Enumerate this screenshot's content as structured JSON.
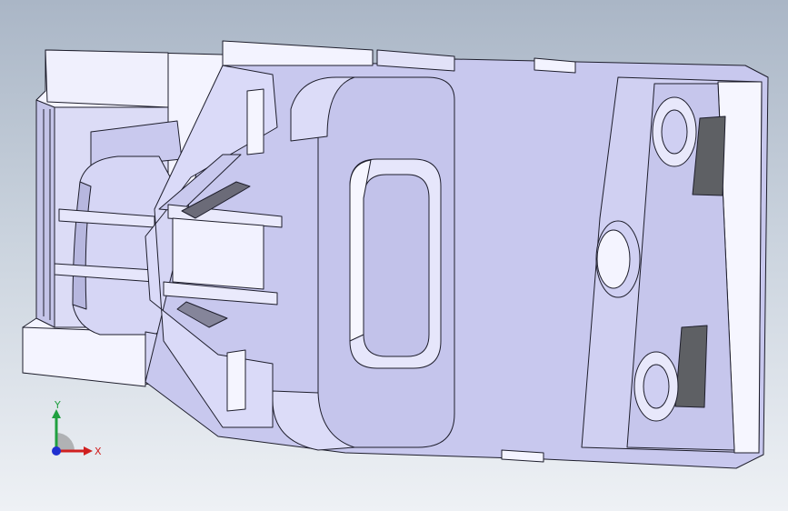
{
  "viewport": {
    "background_top": "#aab6c6",
    "background_bottom": "#eef1f5"
  },
  "model": {
    "face_color": "#c8c8ee",
    "face_light": "#e4e4fa",
    "face_white": "#f4f4ff",
    "shadow_color": "#5e6064",
    "edge_color": "#1e1e2c"
  },
  "triad": {
    "x_label": "X",
    "y_label": "Y",
    "x_color": "#d02020",
    "y_color": "#20a040",
    "z_color": "#2030d0"
  }
}
